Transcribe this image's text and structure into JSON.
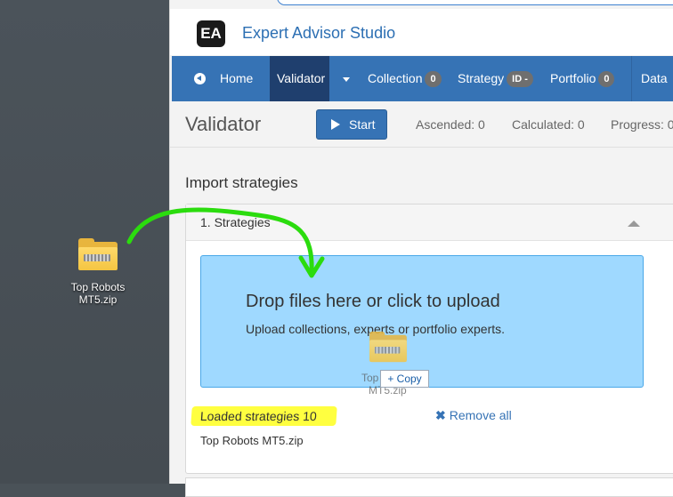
{
  "desktop": {
    "file_icon": "zip-folder-icon",
    "file_label_line1": "Top Robots",
    "file_label_line2": "MT5.zip"
  },
  "app": {
    "logo_text": "EA",
    "brand_name": "Expert Advisor Studio",
    "nav": {
      "home": "Home",
      "validator": "Validator",
      "collection": "Collection",
      "collection_count": "0",
      "strategy": "Strategy",
      "strategy_badge": "ID -",
      "portfolio": "Portfolio",
      "portfolio_count": "0",
      "data": "Data"
    },
    "header": {
      "title": "Validator",
      "start_label": "Start",
      "ascended": "Ascended: 0",
      "calculated": "Calculated: 0",
      "progress": "Progress: 0"
    },
    "section_title": "Import strategies",
    "panel": {
      "title": "1. Strategies",
      "drop_title": "Drop files here or click to upload",
      "drop_subtitle": "Upload collections, experts or portfolio experts.",
      "drag_label_line1": "Top",
      "drag_label_line2": "MT5.zip",
      "copy_tooltip": "+ Copy",
      "loaded_label": "Loaded strategies 10",
      "remove_all": "Remove all",
      "file_name": "Top Robots MT5.zip"
    }
  },
  "colors": {
    "nav_bg": "#3673b5",
    "nav_active": "#1f3f6e",
    "dropzone": "#9fd9ff",
    "highlight": "#ffff40",
    "arrow": "#2bdc0e"
  }
}
